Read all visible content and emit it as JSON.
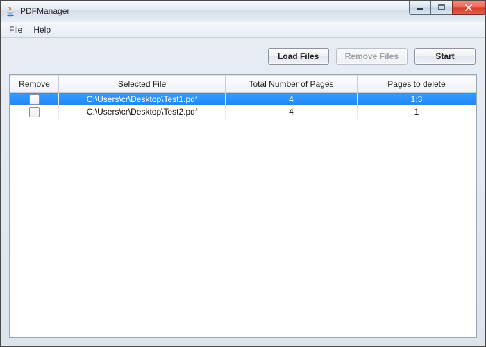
{
  "window": {
    "title": "PDFManager"
  },
  "menu": {
    "file": "File",
    "help": "Help"
  },
  "toolbar": {
    "load_label": "Load Files",
    "remove_label": "Remove Files",
    "remove_enabled": false,
    "start_label": "Start"
  },
  "table": {
    "headers": {
      "remove": "Remove",
      "file": "Selected File",
      "pages": "Total Number of Pages",
      "delete": "Pages to delete"
    },
    "rows": [
      {
        "remove_checked": false,
        "file": "C:\\Users\\cr\\Desktop\\Test1.pdf",
        "pages": "4",
        "delete": "1;3",
        "selected": true
      },
      {
        "remove_checked": false,
        "file": "C:\\Users\\cr\\Desktop\\Test2.pdf",
        "pages": "4",
        "delete": "1",
        "selected": false
      }
    ]
  }
}
